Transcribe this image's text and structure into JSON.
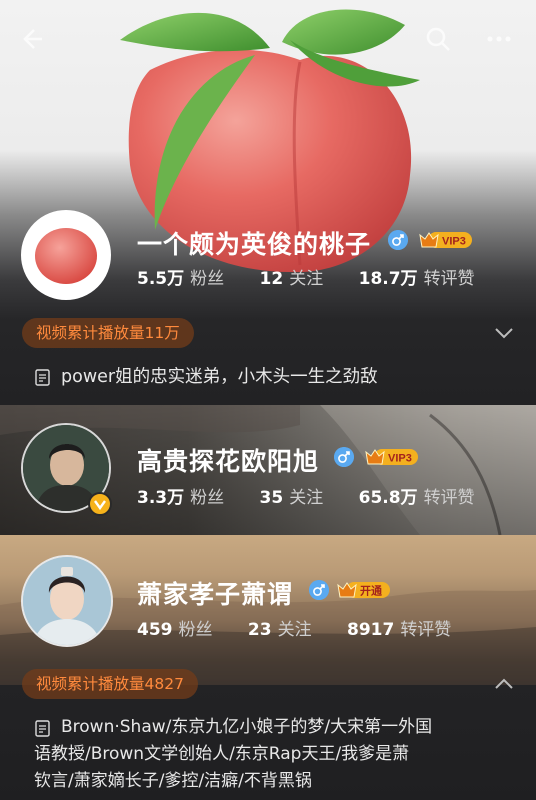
{
  "profiles": [
    {
      "name": "一个颇为英俊的桃子",
      "badge": "VIP3",
      "followers_num": "5.5万",
      "followers_label": "粉丝",
      "following_num": "12",
      "following_label": "关注",
      "likes_num": "18.7万",
      "likes_label": "转评赞",
      "play_count": "视频累计播放量11万",
      "bio": "power姐的忠实迷弟，小木头一生之劲敌"
    },
    {
      "name": "高贵探花欧阳旭",
      "badge": "VIP3",
      "followers_num": "3.3万",
      "followers_label": "粉丝",
      "following_num": "35",
      "following_label": "关注",
      "likes_num": "65.8万",
      "likes_label": "转评赞"
    },
    {
      "name": "萧家孝子萧谓",
      "badge": "开通",
      "followers_num": "459",
      "followers_label": "粉丝",
      "following_num": "23",
      "following_label": "关注",
      "likes_num": "8917",
      "likes_label": "转评赞",
      "play_count": "视频累计播放量4827",
      "bio_lines": [
        "Brown·Shaw/东京九亿小娘子的梦/大宋第一外国",
        "语教授/Brown文学创始人/东京Rap天王/我爹是萧",
        "钦言/萧家嫡长子/爹控/洁癖/不背黑锅"
      ]
    }
  ],
  "colors": {
    "orange": "#ff8a3d",
    "gender_blue": "#5aa9f0",
    "vip_gold": "#f6b21b"
  },
  "icons": [
    "back-arrow-icon",
    "search-icon",
    "more-icon",
    "male-icon",
    "crown-icon",
    "chevron-down-icon",
    "chevron-up-icon",
    "document-icon",
    "verified-icon"
  ]
}
